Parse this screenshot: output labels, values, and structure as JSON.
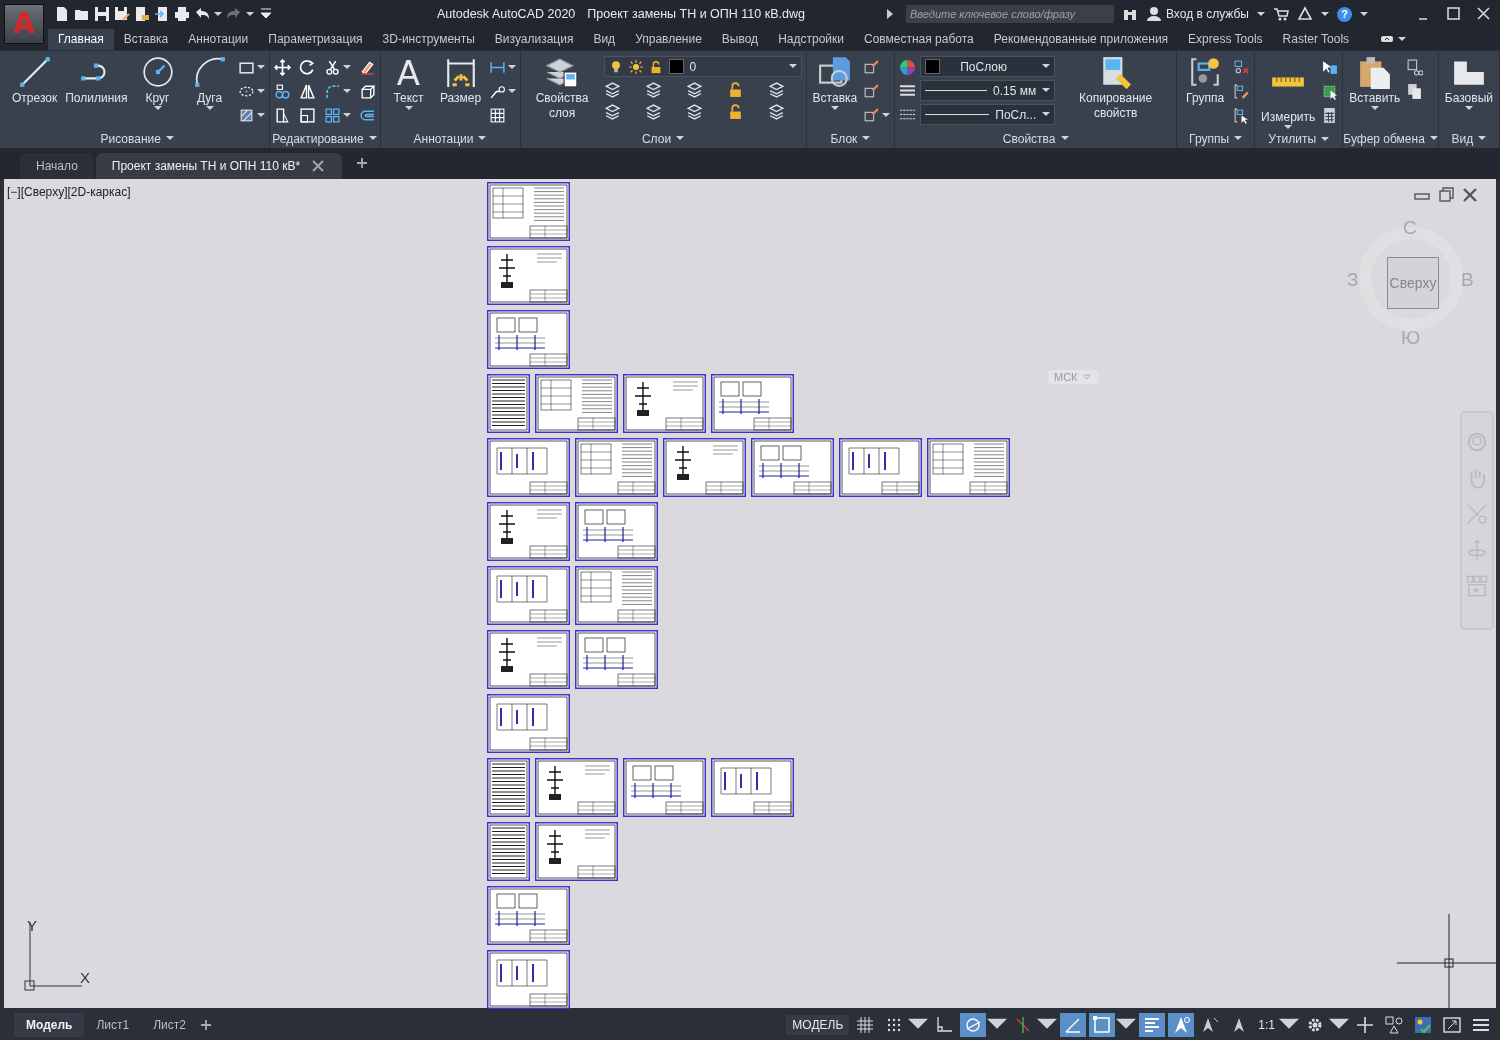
{
  "app_button": {
    "label": "A"
  },
  "title": {
    "app": "Autodesk AutoCAD 2020",
    "file": "Проект замены ТН и ОПН 110 кВ.dwg"
  },
  "search": {
    "placeholder": "Введите ключевое слово/фразу"
  },
  "sign_in": {
    "label": "Вход в службы"
  },
  "help": {
    "label": "?"
  },
  "ribbon_tabs": [
    {
      "label": "Главная",
      "selected": true
    },
    {
      "label": "Вставка",
      "selected": false
    },
    {
      "label": "Аннотации",
      "selected": false
    },
    {
      "label": "Параметризация",
      "selected": false
    },
    {
      "label": "3D-инструменты",
      "selected": false
    },
    {
      "label": "Визуализация",
      "selected": false
    },
    {
      "label": "Вид",
      "selected": false
    },
    {
      "label": "Управление",
      "selected": false
    },
    {
      "label": "Вывод",
      "selected": false
    },
    {
      "label": "Надстройки",
      "selected": false
    },
    {
      "label": "Совместная работа",
      "selected": false
    },
    {
      "label": "Рекомендованные приложения",
      "selected": false
    },
    {
      "label": "Express Tools",
      "selected": false
    },
    {
      "label": "Raster Tools",
      "selected": false
    }
  ],
  "panels": [
    {
      "kind": "draw",
      "title": "Рисование",
      "tools": [
        {
          "label": "Отрезок",
          "menu": false
        },
        {
          "label": "Полилиния",
          "menu": false
        },
        {
          "label": "Круг",
          "menu": true
        },
        {
          "label": "Дуга",
          "menu": true
        }
      ]
    },
    {
      "kind": "modify",
      "title": "Редактирование"
    },
    {
      "kind": "annotate",
      "title": "Аннотации",
      "tools": [
        {
          "label": "Текст",
          "menu": true,
          "glyph": "A"
        },
        {
          "label": "Размер",
          "menu": false
        }
      ]
    },
    {
      "kind": "layers",
      "title": "Слои",
      "tools": [
        {
          "label": "Свойства слоя",
          "menu": false
        }
      ],
      "dropdowns": [
        {
          "kind": "layer",
          "value": "0"
        }
      ]
    },
    {
      "kind": "block",
      "title": "Блок",
      "tools": [
        {
          "label": "Вставка",
          "menu": true
        }
      ]
    },
    {
      "kind": "properties",
      "title": "Свойства",
      "tools": [
        {
          "label": "Копирование свойств",
          "menu": false
        }
      ],
      "dropdowns": [
        {
          "kind": "color",
          "value": "ПоСлою"
        },
        {
          "kind": "lineweight",
          "value": "0.15 мм"
        },
        {
          "kind": "linetype",
          "value": "ПоСл..."
        }
      ]
    },
    {
      "kind": "groups",
      "title": "Группы",
      "tools": [
        {
          "label": "Группа",
          "menu": false
        }
      ]
    },
    {
      "kind": "utilities",
      "title": "Утилиты",
      "tools": [
        {
          "label": "Измерить",
          "menu": true
        }
      ]
    },
    {
      "kind": "clipboard",
      "title": "Буфер обмена",
      "tools": [
        {
          "label": "Вставить",
          "menu": true
        }
      ]
    },
    {
      "kind": "view",
      "title": "Вид",
      "tools": [
        {
          "label": "Базовый",
          "menu": true
        }
      ]
    }
  ],
  "doc_tabs": [
    {
      "label": "Начало",
      "selected": false
    },
    {
      "label": "Проект замены ТН и ОПН 110 кВ*",
      "selected": true
    }
  ],
  "viewport": {
    "label": "[−][Сверху][2D-каркас]"
  },
  "viewcube": {
    "face": "Сверху",
    "north": "С",
    "south": "Ю",
    "west": "З",
    "east": "В",
    "ucs": "МСК"
  },
  "ucs_icon": {
    "x": "X",
    "y": "Y"
  },
  "layout_tabs": [
    {
      "label": "Модель",
      "selected": true
    },
    {
      "label": "Лист1",
      "selected": false
    },
    {
      "label": "Лист2",
      "selected": false
    }
  ],
  "status_bar": {
    "space": "МОДЕЛЬ",
    "tools": [
      {
        "kind": "grid",
        "on": false,
        "menu": false
      },
      {
        "kind": "snap",
        "on": false,
        "menu": true
      },
      {
        "kind": "ortho",
        "on": false,
        "menu": false
      },
      {
        "kind": "polar",
        "on": true,
        "menu": true
      },
      {
        "kind": "isodraft",
        "on": false,
        "menu": true
      },
      {
        "kind": "tracking",
        "on": true,
        "menu": false
      },
      {
        "kind": "osnap",
        "on": true,
        "menu": true
      },
      {
        "kind": "lineweight",
        "on": true,
        "menu": false
      },
      {
        "kind": "annovis",
        "on": true,
        "menu": false
      },
      {
        "kind": "autoscale",
        "on": false,
        "menu": false
      },
      {
        "kind": "annoscale",
        "on": false,
        "menu": false
      },
      {
        "kind": "scale",
        "on": false,
        "menu": true,
        "label": "1:1"
      },
      {
        "kind": "workspace",
        "on": false,
        "menu": true
      },
      {
        "kind": "units",
        "on": false,
        "menu": false
      },
      {
        "kind": "quickprops",
        "on": false,
        "menu": false
      },
      {
        "kind": "isolate",
        "on": false,
        "menu": false
      },
      {
        "kind": "fullscreen",
        "on": false,
        "menu": false
      },
      {
        "kind": "customize",
        "on": false,
        "menu": false
      }
    ]
  }
}
